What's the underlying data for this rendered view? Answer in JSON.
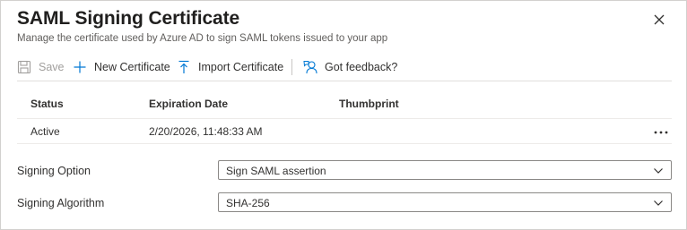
{
  "header": {
    "title": "SAML Signing Certificate",
    "subtitle": "Manage the certificate used by Azure AD to sign SAML tokens issued to your app"
  },
  "toolbar": {
    "save_label": "Save",
    "new_certificate_label": "New Certificate",
    "import_certificate_label": "Import Certificate",
    "feedback_label": "Got feedback?"
  },
  "table": {
    "columns": [
      "Status",
      "Expiration Date",
      "Thumbprint"
    ],
    "rows": [
      {
        "status": "Active",
        "expiration": "2/20/2026, 11:48:33 AM",
        "thumbprint": ""
      }
    ]
  },
  "form": {
    "signing_option": {
      "label": "Signing Option",
      "value": "Sign SAML assertion"
    },
    "signing_algorithm": {
      "label": "Signing Algorithm",
      "value": "SHA-256"
    }
  },
  "colors": {
    "accent": "#0078d4",
    "text": "#323130",
    "muted": "#605e5c",
    "disabled": "#a19f9d"
  },
  "icons": {
    "close": "close-icon",
    "save": "save-icon",
    "new": "plus-icon",
    "import": "upload-icon",
    "feedback": "feedback-icon",
    "more": "more-icon",
    "dropdown": "chevron-down-icon"
  }
}
